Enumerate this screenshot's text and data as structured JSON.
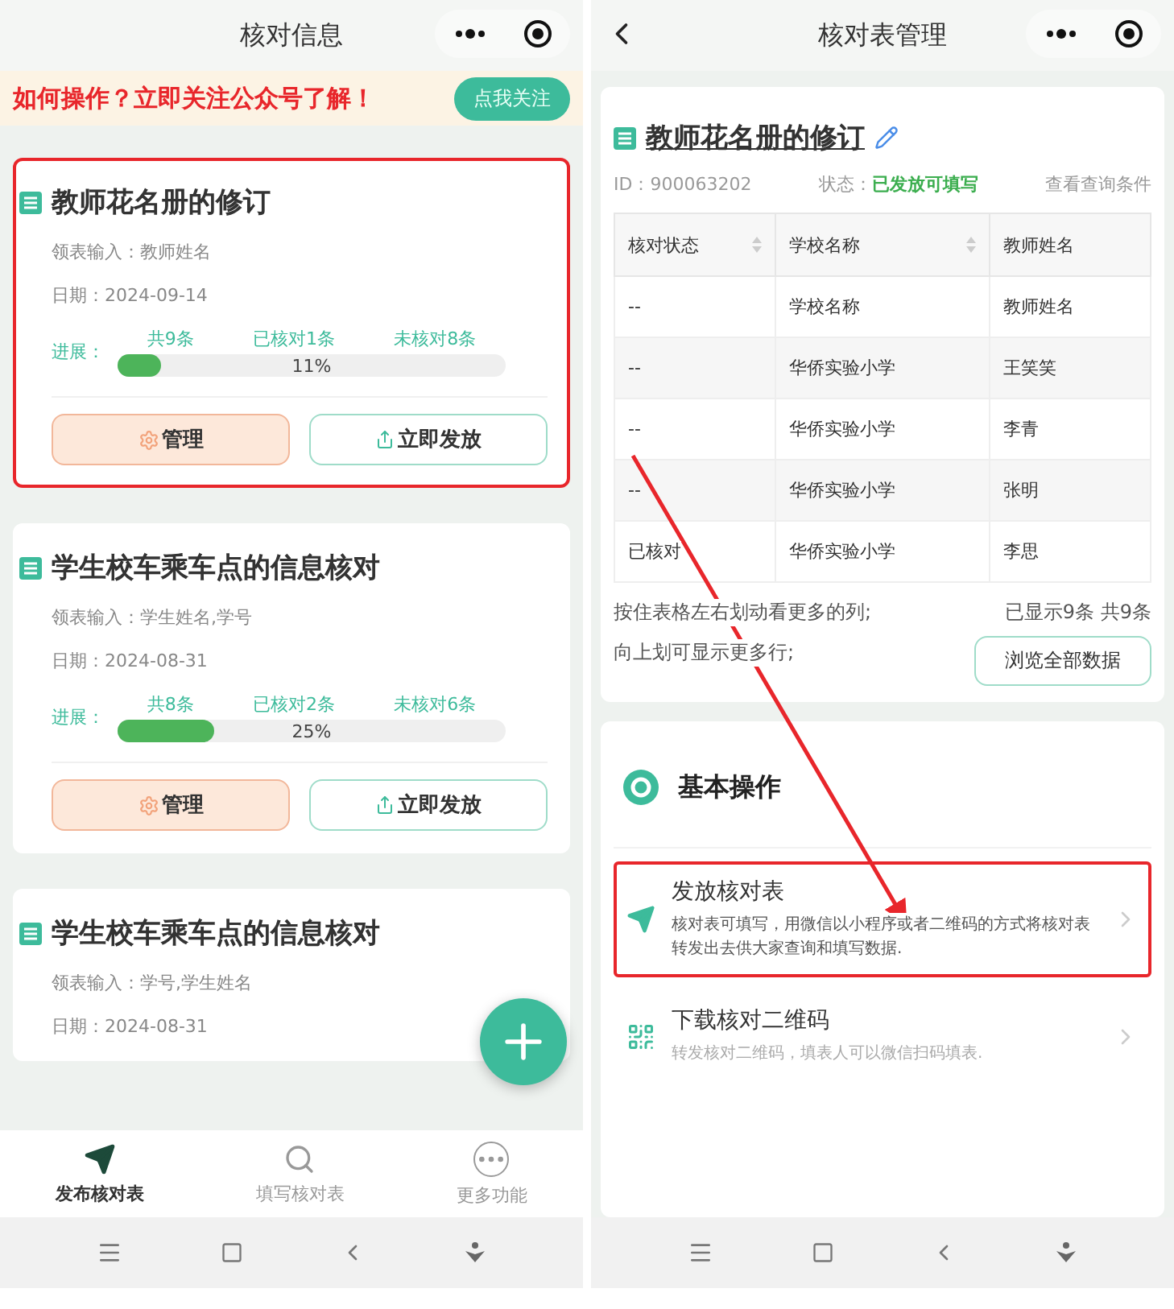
{
  "left": {
    "title": "核对信息",
    "banner": {
      "text": "如何操作？立即关注公众号了解！",
      "button": "点我关注"
    },
    "cards": [
      {
        "title": "教师花名册的修订",
        "input": "领表输入：教师姓名",
        "date": "日期：2024-09-14",
        "progress": {
          "label": "进展：",
          "counts": [
            "共9条",
            "已核对1条",
            "未核对8条"
          ],
          "level": 0.11,
          "percent": "11%"
        },
        "buttons": [
          "管理",
          "立即发放"
        ],
        "highlighted": true
      },
      {
        "title": "学生校车乘车点的信息核对",
        "input": "领表输入：学生姓名,学号",
        "date": "日期：2024-08-31",
        "progress": {
          "label": "进展：",
          "counts": [
            "共8条",
            "已核对2条",
            "未核对6条"
          ],
          "level": 0.25,
          "percent": "25%"
        },
        "buttons": [
          "管理",
          "立即发放"
        ],
        "highlighted": false
      },
      {
        "title": "学生校车乘车点的信息核对",
        "input": "领表输入：学号,学生姓名",
        "date": "日期：2024-08-31",
        "highlighted": false
      }
    ],
    "tabs": [
      {
        "label": "发布核对表",
        "kind": "send",
        "selected": true
      },
      {
        "label": "填写核对表",
        "kind": "search",
        "selected": false
      },
      {
        "label": "更多功能",
        "kind": "more",
        "selected": false
      }
    ]
  },
  "right": {
    "title": "核对表管理",
    "record": {
      "title": "教师花名册的修订",
      "id": "ID：900063202",
      "status_label": "状态：",
      "status": "已发放可填写",
      "link": "查看查询条件",
      "table": {
        "columns": [
          {
            "label": "核对状态",
            "sortable": true
          },
          {
            "label": "学校名称",
            "sortable": true
          },
          {
            "label": "教师姓名",
            "sortable": false
          }
        ],
        "rows": [
          [
            "--",
            "学校名称",
            "教师姓名"
          ],
          [
            "--",
            "华侨实验小学",
            "王笑笑"
          ],
          [
            "--",
            "华侨实验小学",
            "李青"
          ],
          [
            "--",
            "华侨实验小学",
            "张明"
          ],
          [
            "已核对",
            "华侨实验小学",
            "李思"
          ]
        ]
      },
      "hints": [
        "按住表格左右划动看更多的列;",
        "向上划可显示更多行;"
      ],
      "count": "已显示9条 共9条",
      "button": "浏览全部数据"
    },
    "section": {
      "title": "基本操作",
      "items": [
        {
          "kind": "send",
          "title": "发放核对表",
          "description": "核对表可填写，用微信以小程序或者二维码的方式将核对表转发出去供大家查询和填写数据.",
          "highlighted": true
        },
        {
          "kind": "qr",
          "title": "下载核对二维码",
          "description": "转发核对二维码，填表人可以微信扫码填表.",
          "highlighted": false
        }
      ]
    }
  },
  "annotation_arrow": true
}
